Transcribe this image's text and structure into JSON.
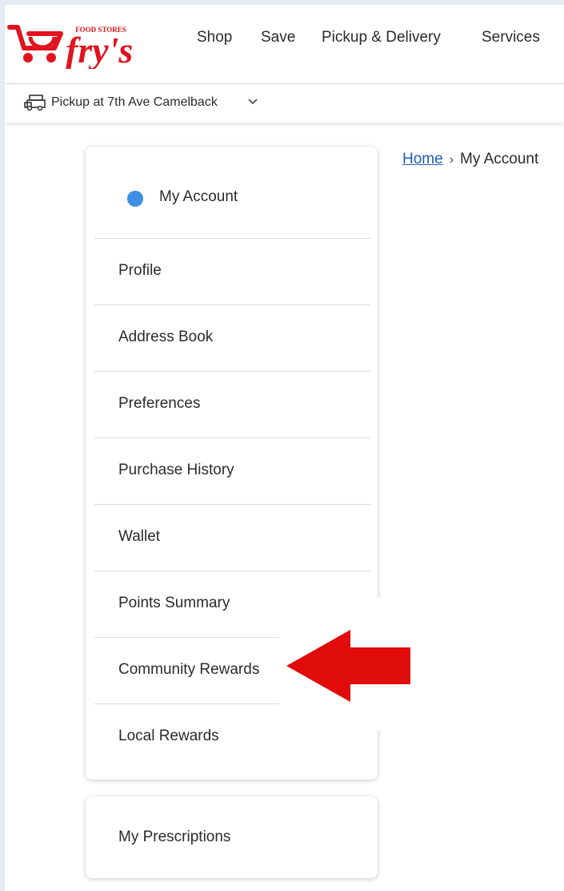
{
  "header": {
    "logo_text": "fry's",
    "logo_subtext": "FOOD STORES",
    "nav": [
      "Shop",
      "Save",
      "Pickup & Delivery",
      "Services"
    ]
  },
  "store": {
    "label": "Pickup at 7th Ave Camelback"
  },
  "breadcrumb": {
    "home": "Home",
    "current": "My Account"
  },
  "sidebar": {
    "title": "My Account",
    "items": [
      {
        "label": "Profile"
      },
      {
        "label": "Address Book"
      },
      {
        "label": "Preferences"
      },
      {
        "label": "Purchase History"
      },
      {
        "label": "Wallet"
      },
      {
        "label": "Points Summary"
      },
      {
        "label": "Community Rewards"
      },
      {
        "label": "Local Rewards"
      }
    ],
    "secondary": "My Prescriptions"
  },
  "colors": {
    "brand_red": "#e0141e",
    "link_blue": "#1f5fb3",
    "active_dot": "#3d8fe3",
    "annotation_arrow": "#e00b0b"
  },
  "icons": {
    "logo": "frys-cart-logo",
    "store": "pickup-store-icon",
    "chevron": "chevron-down-icon",
    "breadcrumb_separator": "chevron-right-icon",
    "annotation": "red-arrow-pointing-left"
  }
}
